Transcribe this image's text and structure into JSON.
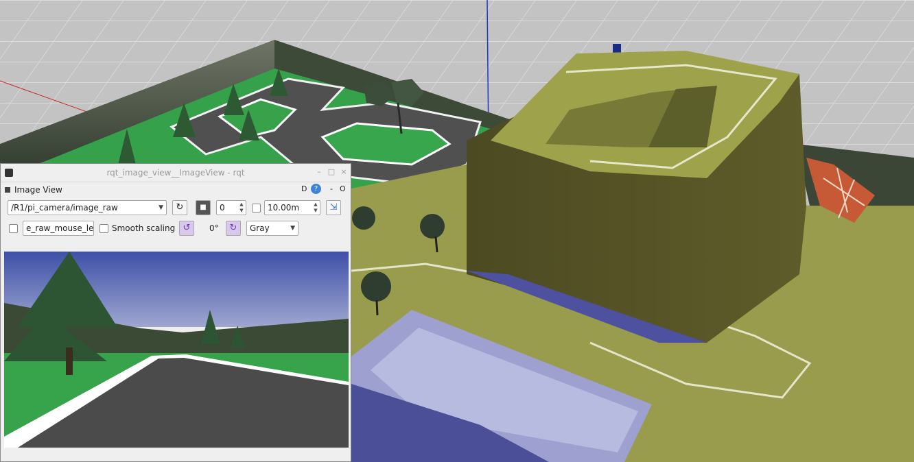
{
  "window": {
    "title": "rqt_image_view__ImageView - rqt",
    "minimize": "–",
    "maximize": "□",
    "close": "×"
  },
  "panel": {
    "title": "Image View",
    "d_label": "D",
    "help_label": "?",
    "minus_label": "-",
    "o_label": "O"
  },
  "toolbar": {
    "topic": "/R1/pi_camera/image_raw",
    "refresh_icon": "refresh-icon",
    "save_icon": "save-icon",
    "spin_value": "0",
    "distance": "10.00m",
    "fit_icon": "fit-window-icon"
  },
  "options": {
    "mouse_topic": "e_raw_mouse_left",
    "smooth_label": "Smooth scaling",
    "rotation": "0°",
    "colormap": "Gray",
    "rotate_left_icon": "rotate-left-icon",
    "rotate_right_icon": "rotate-right-icon"
  }
}
